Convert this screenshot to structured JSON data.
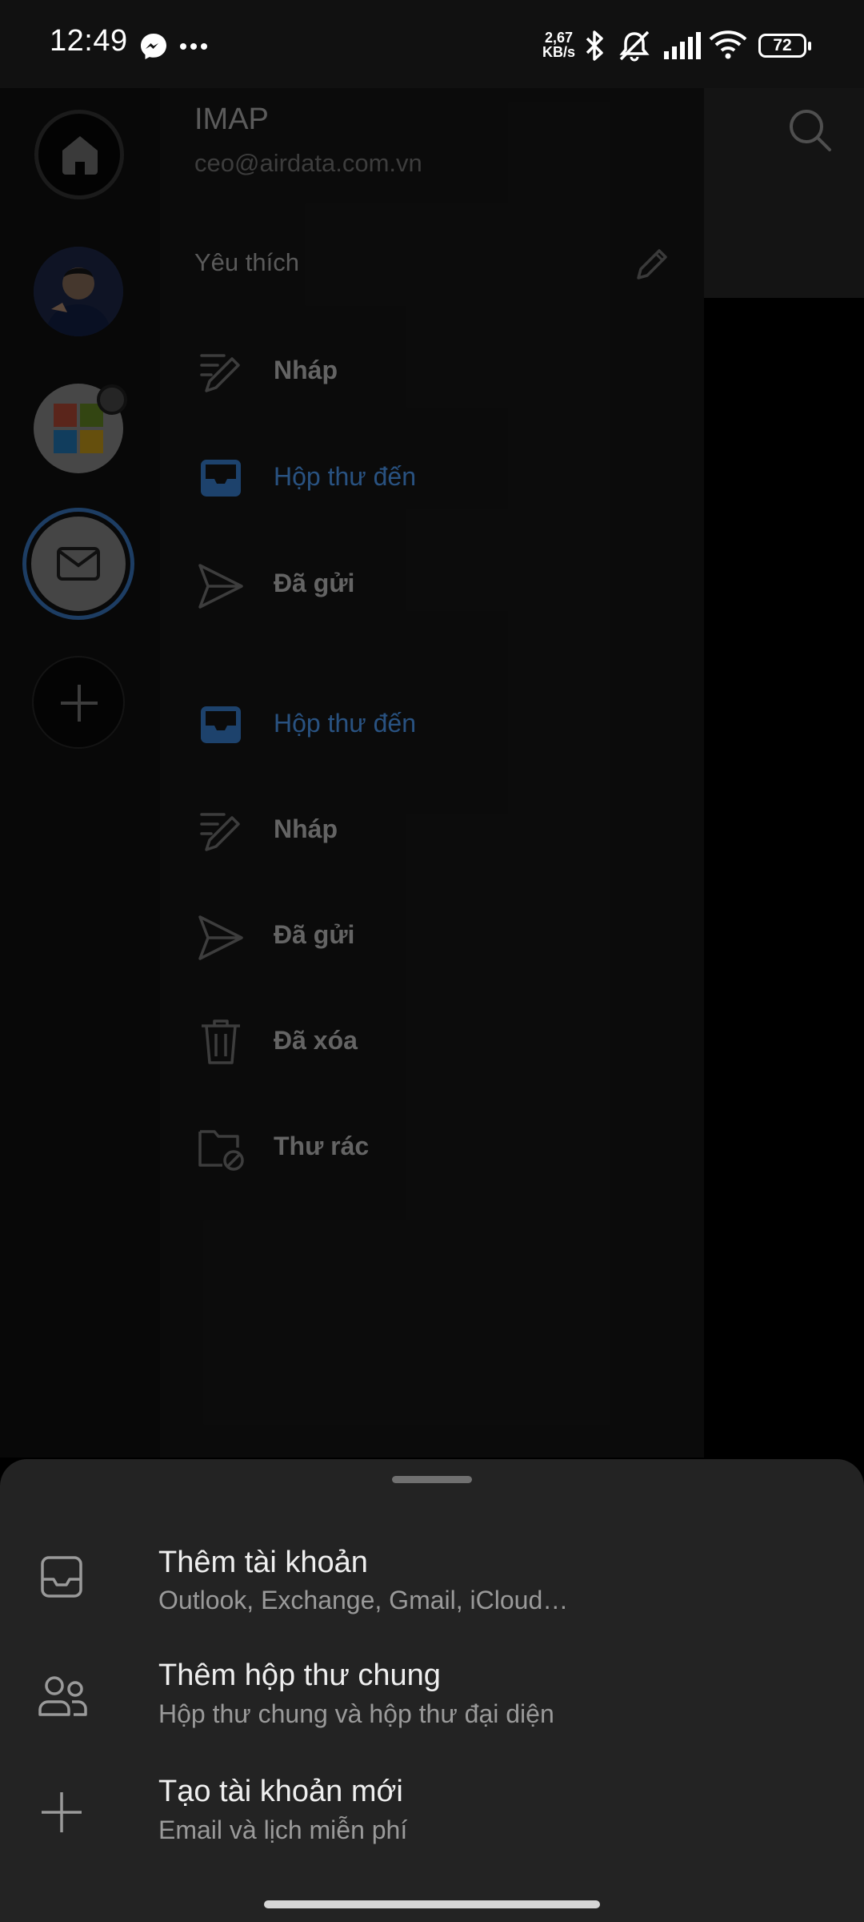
{
  "status_bar": {
    "time": "12:49",
    "net_speed_value": "2,67",
    "net_speed_unit": "KB/s",
    "battery": "72",
    "icons": [
      "messenger-icon",
      "more-dots-icon",
      "bluetooth-icon",
      "mute-icon",
      "signal-icon",
      "wifi-icon",
      "battery-icon"
    ]
  },
  "drawer": {
    "account_title": "IMAP",
    "account_email": "ceo@airdata.com.vn",
    "favorites_label": "Yêu thích",
    "favorites": [
      {
        "label": "Nháp",
        "icon": "draft-icon",
        "active": false
      },
      {
        "label": "Hộp thư đến",
        "icon": "inbox-icon",
        "active": true
      },
      {
        "label": "Đã gửi",
        "icon": "send-icon",
        "active": false
      }
    ],
    "folders": [
      {
        "label": "Hộp thư đến",
        "icon": "inbox-icon",
        "active": true
      },
      {
        "label": "Nháp",
        "icon": "draft-icon",
        "active": false
      },
      {
        "label": "Đã gửi",
        "icon": "send-icon",
        "active": false
      },
      {
        "label": "Đã xóa",
        "icon": "trash-icon",
        "active": false
      },
      {
        "label": "Thư rác",
        "icon": "junk-folder-icon",
        "active": false
      }
    ]
  },
  "bottom_sheet": {
    "options": [
      {
        "title": "Thêm tài khoản",
        "subtitle": "Outlook, Exchange, Gmail, iCloud…",
        "icon": "inbox-tray-icon"
      },
      {
        "title": "Thêm hộp thư chung",
        "subtitle": "Hộp thư chung và hộp thư đại diện",
        "icon": "people-icon"
      },
      {
        "title": "Tạo tài khoản mới",
        "subtitle": "Email và lịch miễn phí",
        "icon": "plus-icon"
      }
    ]
  },
  "colors": {
    "accent": "#3f7fc6",
    "sheet": "#232323",
    "drawer": "#121212"
  }
}
